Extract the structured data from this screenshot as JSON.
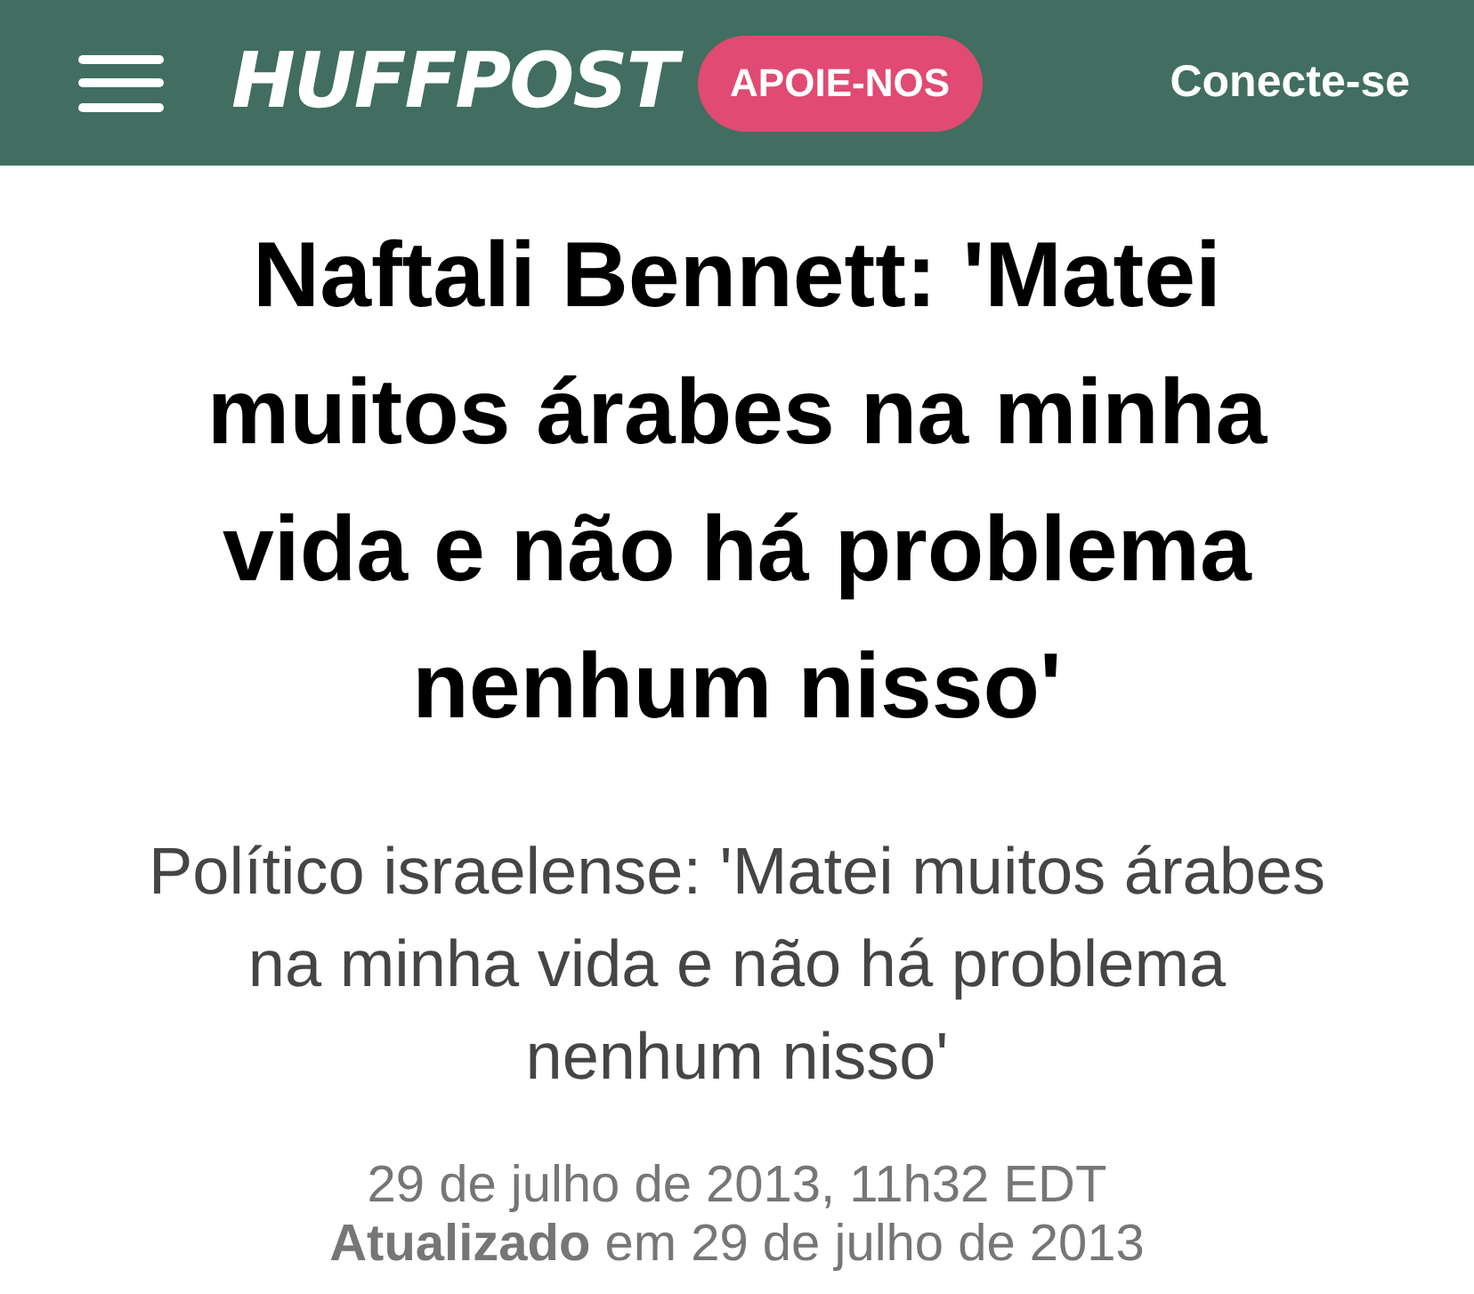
{
  "header": {
    "logo": "HUFFPOST",
    "support_button": "APOIE-NOS",
    "login_link": "Conecte-se"
  },
  "article": {
    "headline": "Naftali Bennett: 'Matei muitos árabes na minha vida e não há problema nenhum nisso'",
    "subheadline": "Político israelense: 'Matei muitos árabes na minha vida e não há problema nenhum nisso'",
    "published": "29 de julho de 2013, 11h32 EDT",
    "updated": "**Atualizado** em 29 de julho de 2013"
  }
}
